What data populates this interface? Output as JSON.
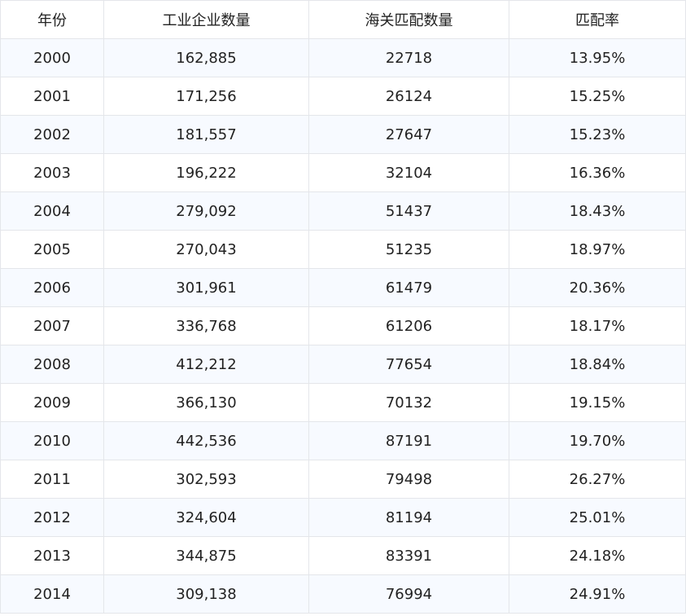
{
  "table": {
    "headers": [
      "年份",
      "工业企业数量",
      "海关匹配数量",
      "匹配率"
    ],
    "rows": [
      [
        "2000",
        "162,885",
        "22718",
        "13.95%"
      ],
      [
        "2001",
        "171,256",
        "26124",
        "15.25%"
      ],
      [
        "2002",
        "181,557",
        "27647",
        "15.23%"
      ],
      [
        "2003",
        "196,222",
        "32104",
        "16.36%"
      ],
      [
        "2004",
        "279,092",
        "51437",
        "18.43%"
      ],
      [
        "2005",
        "270,043",
        "51235",
        "18.97%"
      ],
      [
        "2006",
        "301,961",
        "61479",
        "20.36%"
      ],
      [
        "2007",
        "336,768",
        "61206",
        "18.17%"
      ],
      [
        "2008",
        "412,212",
        "77654",
        "18.84%"
      ],
      [
        "2009",
        "366,130",
        "70132",
        "19.15%"
      ],
      [
        "2010",
        "442,536",
        "87191",
        "19.70%"
      ],
      [
        "2011",
        "302,593",
        "79498",
        "26.27%"
      ],
      [
        "2012",
        "324,604",
        "81194",
        "25.01%"
      ],
      [
        "2013",
        "344,875",
        "83391",
        "24.18%"
      ],
      [
        "2014",
        "309,138",
        "76994",
        "24.91%"
      ]
    ]
  },
  "colors": {
    "row_stripe": "#f7faff",
    "border": "#e4e6ea",
    "text": "#222222"
  }
}
